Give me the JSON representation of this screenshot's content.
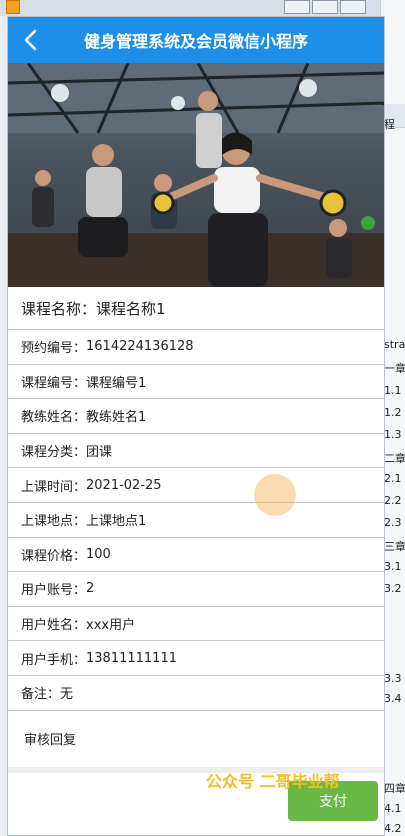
{
  "nav": {
    "title": "健身管理系统及会员微信小程序"
  },
  "hero": {
    "image_name": "gym-class-photo",
    "caption": "",
    "overlay_text": ""
  },
  "course": {
    "name_label": "课程名称：",
    "name_value": "课程名称1",
    "rows": [
      {
        "label": "预约编号：",
        "value": "1614224136128"
      },
      {
        "label": "课程编号：",
        "value": "课程编号1"
      },
      {
        "label": "教练姓名：",
        "value": "教练姓名1"
      },
      {
        "label": "课程分类：",
        "value": "团课"
      },
      {
        "label": "上课时间：",
        "value": "2021-02-25"
      },
      {
        "label": "上课地点：",
        "value": "上课地点1"
      },
      {
        "label": "课程价格：",
        "value": "100"
      },
      {
        "label": "用户账号：",
        "value": "2"
      },
      {
        "label": "用户姓名：",
        "value": "xxx用户"
      },
      {
        "label": "用户手机：",
        "value": "13811111111"
      },
      {
        "label": "备注：",
        "value": "无"
      }
    ]
  },
  "reply": {
    "label": "审核回复"
  },
  "footer": {
    "pay_label": "支付"
  },
  "watermark": {
    "text": "公众号 二哥毕业帮"
  },
  "background_window": {
    "lines": [
      "程",
      "stra",
      "一章",
      "1.1",
      "1.2",
      "1.3",
      "二章",
      "2.1",
      "2.2",
      "2.3",
      "三章",
      "3.1",
      "3.2",
      "3.3",
      "3.4",
      "四章",
      "4.1",
      "4.2"
    ]
  },
  "colors": {
    "nav": "#1e8fe8",
    "pay": "#6ab947",
    "watermark": "#f4bf1c"
  }
}
